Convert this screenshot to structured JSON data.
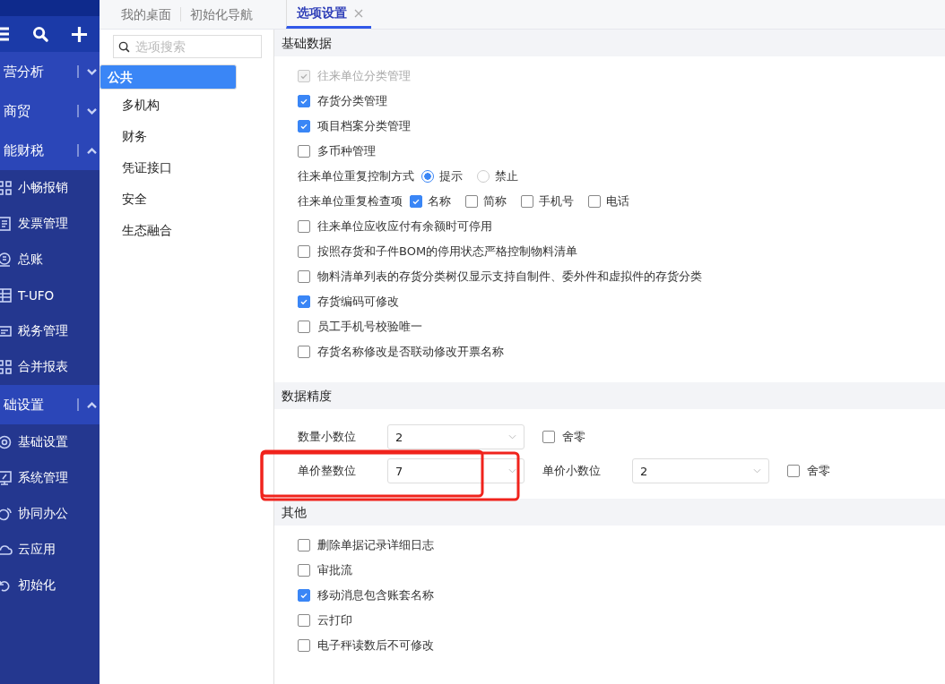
{
  "sidebar": {
    "groups": [
      {
        "label": "营分析",
        "expanded": false
      },
      {
        "label": "商贸",
        "expanded": false
      },
      {
        "label": "能财税",
        "expanded": true,
        "items": [
          {
            "label": "小畅报销"
          },
          {
            "label": "发票管理"
          },
          {
            "label": "总账"
          },
          {
            "label": "T-UFO"
          },
          {
            "label": "税务管理"
          },
          {
            "label": "合并报表"
          }
        ]
      },
      {
        "label": "础设置",
        "expanded": true,
        "items": [
          {
            "label": "基础设置"
          },
          {
            "label": "系统管理"
          },
          {
            "label": "协同办公"
          },
          {
            "label": "云应用"
          },
          {
            "label": "初始化"
          }
        ]
      }
    ]
  },
  "tabs": [
    {
      "label": "我的桌面",
      "selected": false
    },
    {
      "label": "初始化导航",
      "selected": false
    },
    {
      "label": "选项设置",
      "selected": true
    }
  ],
  "options_panel": {
    "search": {
      "placeholder": "选项搜索"
    },
    "categories": [
      {
        "label": "公共",
        "selected": true
      },
      {
        "label": "多机构",
        "selected": false
      },
      {
        "label": "财务",
        "selected": false
      },
      {
        "label": "凭证接口",
        "selected": false
      },
      {
        "label": "安全",
        "selected": false
      },
      {
        "label": "生态融合",
        "selected": false
      }
    ]
  },
  "sections": [
    {
      "title": "基础数据",
      "rows": [
        {
          "kind": "checkbox",
          "label": "往来单位分类管理",
          "checked": true,
          "disabled": true
        },
        {
          "kind": "checkbox",
          "label": "存货分类管理",
          "checked": true,
          "disabled": false
        },
        {
          "kind": "checkbox",
          "label": "项目档案分类管理",
          "checked": true,
          "disabled": false
        },
        {
          "kind": "checkbox",
          "label": "多币种管理",
          "checked": false
        },
        {
          "kind": "radio",
          "label": "往来单位重复控制方式",
          "options": [
            {
              "label": "提示",
              "selected": true
            },
            {
              "label": "禁止",
              "selected": false
            }
          ]
        },
        {
          "kind": "checks",
          "label": "往来单位重复检查项",
          "options": [
            {
              "label": "名称",
              "checked": true
            },
            {
              "label": "简称",
              "checked": false
            },
            {
              "label": "手机号",
              "checked": false
            },
            {
              "label": "电话",
              "checked": false
            }
          ]
        },
        {
          "kind": "checkbox",
          "label": "往来单位应收应付有余额时可停用",
          "checked": false
        },
        {
          "kind": "checkbox",
          "label": "按照存货和子件BOM的停用状态严格控制物料清单",
          "checked": false
        },
        {
          "kind": "checkbox",
          "label": "物料清单列表的存货分类树仅显示支持自制件、委外件和虚拟件的存货分类",
          "checked": false
        },
        {
          "kind": "checkbox",
          "label": "存货编码可修改",
          "checked": true,
          "disabled": false
        },
        {
          "kind": "checkbox",
          "label": "员工手机号校验唯一",
          "checked": false
        },
        {
          "kind": "checkbox",
          "label": "存货名称修改是否联动修改开票名称",
          "checked": false
        }
      ]
    },
    {
      "title": "数据精度",
      "rows": [
        {
          "kind": "fields",
          "items": [
            {
              "kind": "select",
              "label": "数量小数位",
              "value": "2"
            },
            {
              "kind": "checkbox",
              "label": "舍零",
              "checked": false
            }
          ]
        },
        {
          "kind": "fields",
          "highlighted": true,
          "items": [
            {
              "kind": "select",
              "label": "单价整数位",
              "value": "7"
            },
            {
              "kind": "select",
              "label": "单价小数位",
              "value": "2"
            },
            {
              "kind": "checkbox",
              "label": "舍零",
              "checked": false
            }
          ]
        }
      ]
    },
    {
      "title": "其他",
      "rows": [
        {
          "kind": "checkbox",
          "label": "删除单据记录详细日志",
          "checked": false
        },
        {
          "kind": "checkbox",
          "label": "审批流",
          "checked": false
        },
        {
          "kind": "checkbox",
          "label": "移动消息包含账套名称",
          "checked": true
        },
        {
          "kind": "checkbox",
          "label": "云打印",
          "checked": false
        },
        {
          "kind": "checkbox",
          "label": "电子秤读数后不可修改",
          "checked": false
        }
      ]
    }
  ]
}
